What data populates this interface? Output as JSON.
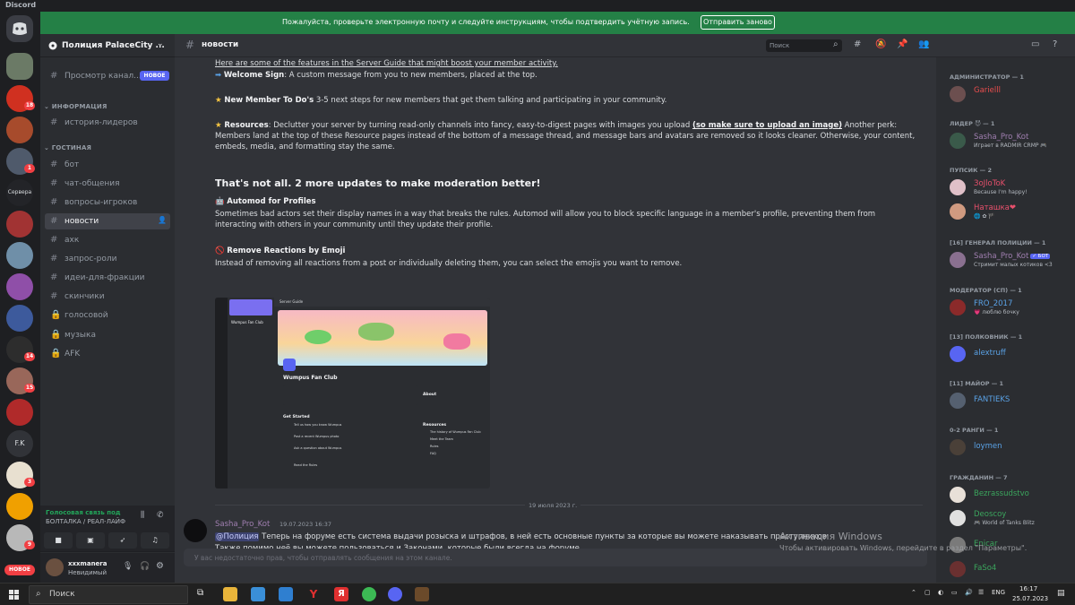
{
  "app": {
    "title": "Discord"
  },
  "notice": {
    "message": "Пожалуйста, проверьте электронную почту и следуйте инструкциям, чтобы подтвердить учётную запись.",
    "button": "Отправить заново"
  },
  "guilds": {
    "badges": [
      "18",
      "1",
      "14",
      "15",
      "3",
      "9"
    ],
    "labels": [
      "Сервера",
      "F.K"
    ],
    "new_badge": "НОВОЕ"
  },
  "server": {
    "name": "Полиция PalaceCity ..."
  },
  "sidebar": {
    "browse": {
      "label": "Просмотр канал...",
      "badge": "НОВОЕ"
    },
    "categories": [
      {
        "label": "ИНФОРМАЦИЯ",
        "channels": [
          {
            "label": "история-лидеров"
          }
        ]
      },
      {
        "label": "ГОСТИНАЯ",
        "channels": [
          {
            "label": "бот"
          },
          {
            "label": "чат-общения"
          },
          {
            "label": "вопросы-игроков"
          },
          {
            "label": "новости"
          },
          {
            "label": "ахк"
          },
          {
            "label": "запрос-роли"
          },
          {
            "label": "идеи-для-фракции"
          },
          {
            "label": "скинчики"
          },
          {
            "label": "голосовой"
          },
          {
            "label": "музыка"
          },
          {
            "label": "AFK"
          }
        ]
      }
    ]
  },
  "voice": {
    "status": "Голосовая связь под",
    "channel": "БОЛТАЛКА / РЕАЛ-ЛАЙФ"
  },
  "user": {
    "name": "xxxmanera",
    "status": "Невидимый"
  },
  "channel": {
    "name": "новости",
    "search_placeholder": "Поиск"
  },
  "content": {
    "intro": "Here are some of the features in the Server Guide that might boost your member activity.",
    "welcome_title": "Welcome Sign",
    "welcome_text": ": A custom message from you to new members, placed at the top.",
    "todo_title": "New Member To Do's",
    "todo_text": " 3-5 next steps for new members that get them talking and participating in your community.",
    "resources_title": "Resources",
    "resources_text": ": Declutter your server by turning read-only channels into fancy, easy-to-digest pages with images you upload ",
    "resources_bold": "(so make sure to upload an image)",
    "resources_text2": " Another perk: Members land at the top of these Resource pages instead of the bottom of a message thread, and message bars and avatars are removed so it looks cleaner. Otherwise, your content, embeds, media, and formatting stay the same.",
    "heading": "That's not all. 2 more updates to make moderation better!",
    "automod_title": "Automod for Profiles",
    "automod_text": "Sometimes bad actors set their display names in a way that breaks the rules. Automod will allow you to block specific language in a member's profile, preventing them from interacting with others in your community until they update their profile.",
    "reactions_title": "Remove Reactions by Emoji",
    "reactions_text": "Instead of removing all reactions from a post or individually deleting them, you can select the emojis you want to remove.",
    "embed": {
      "server_name": "Wumpus Fan Club",
      "tab": "Server Guide",
      "about": "About",
      "get_started": "Get Started",
      "resources": "Resources",
      "steps": [
        "Tell us how you know Wumpus",
        "Post a recent Wumpus photo",
        "Ask a question about Wumpus",
        "Read the Rules"
      ],
      "resource_items": [
        "The history of Wumpus Fan Club",
        "Meet the Team",
        "Rules",
        "FAQ"
      ]
    }
  },
  "message": {
    "date": "19 июля 2023 г.",
    "author": "Sasha_Pro_Kot",
    "timestamp": "19.07.2023 16:37",
    "mention": "@Полиция",
    "text1": " Теперь на форуме есть система выдачи розыска и штрафов, в ней есть основные пункты за которые вы можете наказывать преступников.",
    "text2": "Также помимо неё вы можете пользоваться и Законами, которые были всегда на форуме."
  },
  "composer": {
    "placeholder": "У вас недостаточно прав, чтобы отправлять сообщения на этом канале."
  },
  "members": [
    {
      "cat": "АДМИНИСТРАТОР — 1",
      "items": [
        {
          "name": "Garielll",
          "color": "#e84d4d",
          "status": ""
        }
      ]
    },
    {
      "cat": "ЛИДЕР 😈 — 1",
      "items": [
        {
          "name": "Sasha_Pro_Kot",
          "color": "#a07fb0",
          "status": "Играет в RADMIR CRMP 🎮"
        }
      ]
    },
    {
      "cat": "ПУПСИК — 2",
      "items": [
        {
          "name": "ЗоJloToK",
          "color": "#e8506c",
          "status": "Because I'm happy!"
        },
        {
          "name": "Наташка❤",
          "color": "#e8506c",
          "status": "🌐 ✿ 🏴"
        }
      ]
    },
    {
      "cat": "[16] ГЕНЕРАЛ ПОЛИЦИИ — 1",
      "items": [
        {
          "name": "Sasha_Pro_Kot",
          "color": "#a07fb0",
          "status": "Стримит малых котиков <3",
          "bot": "✓ БОТ"
        }
      ]
    },
    {
      "cat": "МОДЕРАТОР (СП) — 1",
      "items": [
        {
          "name": "FRO_2017",
          "color": "#5aa2e6",
          "status": "💗 люблю бочку"
        }
      ]
    },
    {
      "cat": "[13] ПОЛКОВНИК — 1",
      "items": [
        {
          "name": "alextruff",
          "color": "#5aa2e6",
          "status": ""
        }
      ]
    },
    {
      "cat": "[11] МАЙОР — 1",
      "items": [
        {
          "name": "FANTIEKS",
          "color": "#5aa2e6",
          "status": ""
        }
      ]
    },
    {
      "cat": "0-2 РАНГИ — 1",
      "items": [
        {
          "name": "loymen",
          "color": "#5aa2e6",
          "status": ""
        }
      ]
    },
    {
      "cat": "ГРАЖДАНИН — 7",
      "items": [
        {
          "name": "Bezrassudstvo",
          "color": "#3ba55d",
          "status": ""
        },
        {
          "name": "Deoscoy",
          "color": "#3ba55d",
          "status": "🎮 World of Tanks Blitz"
        },
        {
          "name": "Enicar",
          "color": "#3ba55d",
          "status": ""
        },
        {
          "name": "FaSo4",
          "color": "#3ba55d",
          "status": ""
        }
      ]
    }
  ],
  "watermark": {
    "line1": "Активация Windows",
    "line2": "Чтобы активировать Windows, перейдите в раздел \"Параметры\"."
  },
  "taskbar": {
    "search": "Поиск",
    "lang": "ENG",
    "time": "16:17",
    "date": "25.07.2023"
  }
}
